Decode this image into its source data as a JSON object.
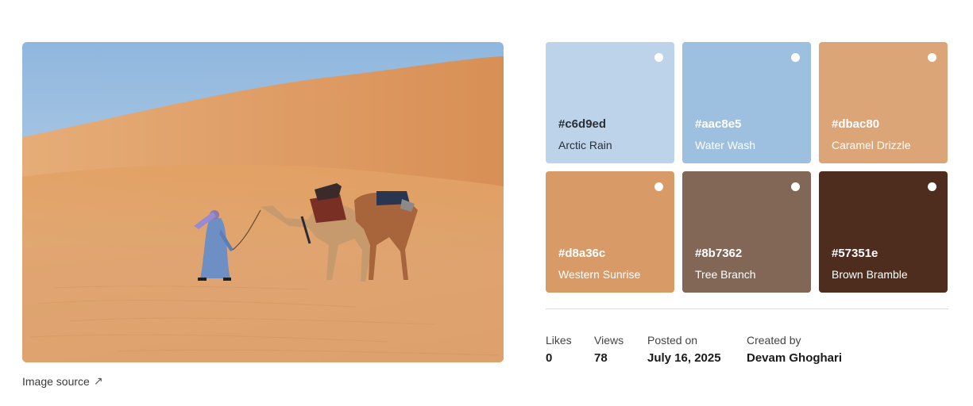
{
  "image": {
    "alt": "Desert dunes with a man leading two camels",
    "source_label": "Image source",
    "source_icon": "external-arrow-icon"
  },
  "palette": [
    {
      "hex": "#c6d9ed",
      "name": "Arctic Rain",
      "bg": "#bcd3ea",
      "text": "dark"
    },
    {
      "hex": "#aac8e5",
      "name": "Water Wash",
      "bg": "#9dc0e0",
      "text": "light"
    },
    {
      "hex": "#dbac80",
      "name": "Caramel Drizzle",
      "bg": "#dca578",
      "text": "light"
    },
    {
      "hex": "#d8a36c",
      "name": "Western Sunrise",
      "bg": "#d89a66",
      "text": "light"
    },
    {
      "hex": "#8b7362",
      "name": "Tree Branch",
      "bg": "#826656",
      "text": "light"
    },
    {
      "hex": "#57351e",
      "name": "Brown Bramble",
      "bg": "#4f2d1e",
      "text": "light"
    }
  ],
  "stats": {
    "likes_label": "Likes",
    "likes_value": "0",
    "views_label": "Views",
    "views_value": "78",
    "posted_label": "Posted on",
    "posted_value": "July 16, 2025",
    "created_label": "Created by",
    "created_value": "Devam Ghoghari"
  }
}
